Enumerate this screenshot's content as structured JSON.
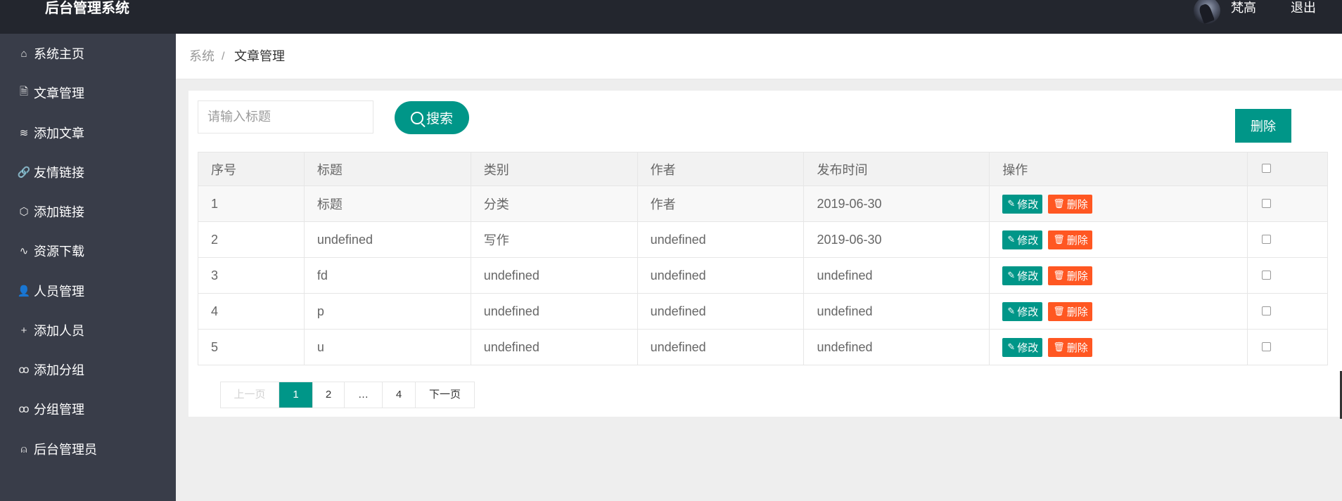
{
  "header": {
    "logo": "后台管理系统",
    "username": "梵高",
    "logout": "退出"
  },
  "sidebar": {
    "items": [
      {
        "label": "系统主页",
        "icon": "home-icon",
        "glyph": "⌂"
      },
      {
        "label": "文章管理",
        "icon": "document-icon",
        "glyph": "🗎"
      },
      {
        "label": "添加文章",
        "icon": "layers-icon",
        "glyph": "≋"
      },
      {
        "label": "友情链接",
        "icon": "link-icon",
        "glyph": "🔗"
      },
      {
        "label": "添加链接",
        "icon": "cube-icon",
        "glyph": "⬡"
      },
      {
        "label": "资源下载",
        "icon": "pulse-icon",
        "glyph": "∿"
      },
      {
        "label": "人员管理",
        "icon": "user-icon",
        "glyph": "👤"
      },
      {
        "label": "添加人员",
        "icon": "plus-icon",
        "glyph": "+"
      },
      {
        "label": "添加分组",
        "icon": "group-icon",
        "glyph": "ꝏ"
      },
      {
        "label": "分组管理",
        "icon": "group-icon",
        "glyph": "ꝏ"
      },
      {
        "label": "后台管理员",
        "icon": "admin-icon",
        "glyph": "⍝"
      }
    ]
  },
  "breadcrumb": {
    "home": "系统",
    "separator": "/",
    "current": "文章管理"
  },
  "toolbar": {
    "search_placeholder": "请输入标题",
    "search_label": "搜索",
    "delete_label": "删除"
  },
  "table": {
    "headers": [
      "序号",
      "标题",
      "类别",
      "作者",
      "发布时间",
      "操作"
    ],
    "edit_label": "修改",
    "delete_label": "删除",
    "rows": [
      {
        "no": "1",
        "title": "标题",
        "category": "分类",
        "author": "作者",
        "date": "2019-06-30"
      },
      {
        "no": "2",
        "title": "undefined",
        "category": "写作",
        "author": "undefined",
        "date": "2019-06-30"
      },
      {
        "no": "3",
        "title": "fd",
        "category": "undefined",
        "author": "undefined",
        "date": "undefined"
      },
      {
        "no": "4",
        "title": "p",
        "category": "undefined",
        "author": "undefined",
        "date": "undefined"
      },
      {
        "no": "5",
        "title": "u",
        "category": "undefined",
        "author": "undefined",
        "date": "undefined"
      }
    ]
  },
  "pagination": {
    "prev": "上一页",
    "pages": [
      "1",
      "2",
      "…",
      "4"
    ],
    "next": "下一页",
    "current": "1"
  },
  "colors": {
    "header_bg": "#23262e",
    "sidebar_bg": "#393d49",
    "accent": "#009688",
    "danger": "#ff5722"
  }
}
